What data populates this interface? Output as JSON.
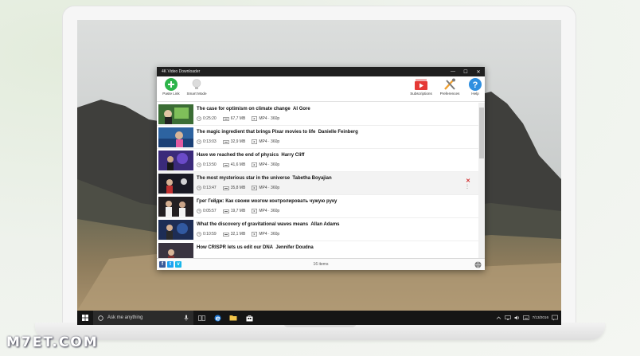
{
  "app": {
    "title": "4K Video Downloader",
    "window_controls": {
      "minimize": "—",
      "maximize": "☐",
      "close": "✕"
    }
  },
  "toolbar": {
    "paste_link": "Paste Link",
    "smart_mode": "Smart Mode",
    "subscriptions": "Subscriptions",
    "preferences": "Preferences",
    "help": "Help",
    "help_glyph": "?",
    "paste_glyph": "+"
  },
  "downloads": [
    {
      "title": "The case for optimism on climate change",
      "author": "Al Gore",
      "duration": "0:25:20",
      "size": "67,7 MB",
      "format": "MP4 · 360p",
      "thumb_color": "#3b6d35"
    },
    {
      "title": "The magic ingredient that brings Pixar movies to life",
      "author": "Danielle Feinberg",
      "duration": "0:13:03",
      "size": "32,9 MB",
      "format": "MP4 · 360p",
      "thumb_color": "#2d63a0"
    },
    {
      "title": "Have we reached the end of physics",
      "author": "Harry Cliff",
      "duration": "0:13:50",
      "size": "41,6 MB",
      "format": "MP4 · 360p",
      "thumb_color": "#3a2a7a"
    },
    {
      "title": "The most mysterious star in the universe",
      "author": "Tabetha Boyajian",
      "duration": "0:13:47",
      "size": "35,8 MB",
      "format": "MP4 · 360p",
      "thumb_color": "#1a1a24"
    },
    {
      "title": "Грег Гейдж: Как своим мозгом контролировать чужую руку",
      "author": "",
      "duration": "0:05:57",
      "size": "19,7 MB",
      "format": "MP4 · 360p",
      "thumb_color": "#231f22"
    },
    {
      "title": "What the discovery of gravitational waves means",
      "author": "Allan Adams",
      "duration": "0:10:59",
      "size": "32,1 MB",
      "format": "MP4 · 360p",
      "thumb_color": "#1d2d55"
    },
    {
      "title": "How CRISPR lets us edit our DNA",
      "author": "Jennifer Doudna",
      "duration": "",
      "size": "",
      "format": "",
      "thumb_color": "#3a3440"
    }
  ],
  "row_actions": {
    "remove": "✕",
    "more": "⋮"
  },
  "status": {
    "count": "16 items"
  },
  "social": [
    {
      "name": "facebook",
      "glyph": "f",
      "color": "#3b5998"
    },
    {
      "name": "twitter",
      "glyph": "t",
      "color": "#1da1f2"
    },
    {
      "name": "vimeo",
      "glyph": "v",
      "color": "#1ab7ea"
    }
  ],
  "taskbar": {
    "search_placeholder": "Ask me anything",
    "clock_time": "",
    "clock_date": "7/13/2016"
  },
  "watermark": "M7ET.COM",
  "colors": {
    "accent_green": "#2db44a",
    "help_blue": "#2f8fe0",
    "remove_red": "#d02a2a",
    "subscriptions_red": "#e53935"
  }
}
